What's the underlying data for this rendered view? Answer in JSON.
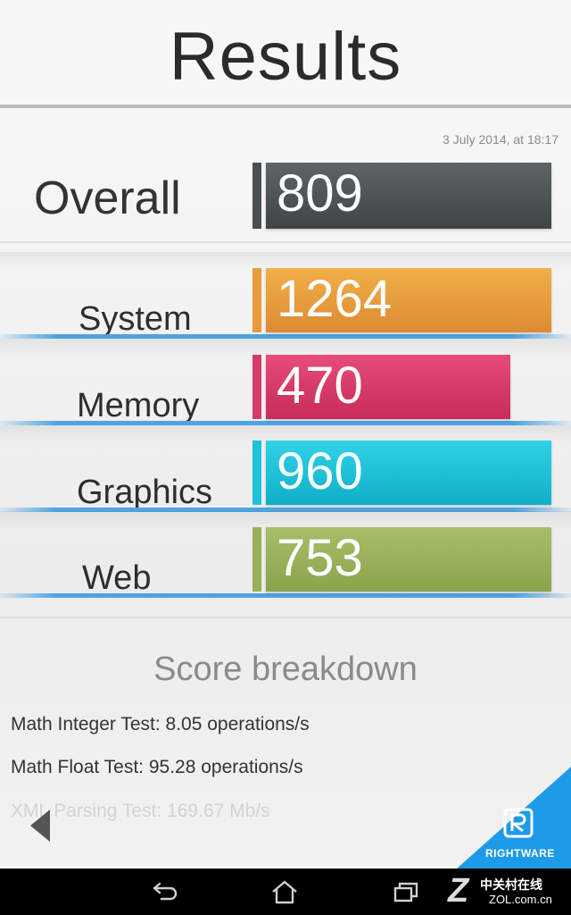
{
  "header": {
    "title": "Results"
  },
  "date": "3 July 2014, at 18:17",
  "overall": {
    "label": "Overall",
    "score": "809",
    "color": "#4b5052"
  },
  "categories": [
    {
      "label": "System",
      "score": "1264",
      "color": "#e89a3c"
    },
    {
      "label": "Memory",
      "score": "470",
      "color": "#d63a68"
    },
    {
      "label": "Graphics",
      "score": "960",
      "color": "#1fc2d8"
    },
    {
      "label": "Web",
      "score": "753",
      "color": "#98b05a"
    }
  ],
  "breakdown": {
    "title": "Score breakdown",
    "tests": [
      "Math Integer Test: 8.05 operations/s",
      "Math Float Test: 95.28 operations/s",
      "XML Parsing Test: 169.67 Mb/s"
    ]
  },
  "badge": {
    "label": "RIGHTWARE"
  },
  "watermark": {
    "cn": "中关村在线",
    "en": "ZOL.com.cn"
  },
  "icons": [
    "back-arrow-icon",
    "nav-back-icon",
    "nav-home-icon",
    "nav-recent-apps-icon",
    "rightware-logo-icon"
  ]
}
